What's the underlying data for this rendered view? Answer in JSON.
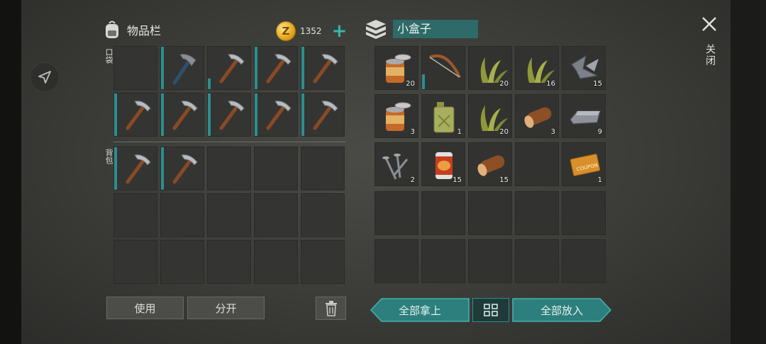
{
  "inventory": {
    "title": "物品栏",
    "coins": "1352",
    "pocket_label": "口袋",
    "backpack_label": "背包",
    "pocket_slots": [
      {
        "item": "",
        "qty": "",
        "durability": 0
      },
      {
        "item": "stone-pickaxe-icon",
        "qty": "",
        "durability": 1.0
      },
      {
        "item": "pickaxe-icon",
        "qty": "",
        "durability": 0.25
      },
      {
        "item": "pickaxe-icon",
        "qty": "",
        "durability": 1.0
      },
      {
        "item": "pickaxe-icon",
        "qty": "",
        "durability": 1.0
      },
      {
        "item": "pickaxe-icon",
        "qty": "",
        "durability": 1.0
      },
      {
        "item": "pickaxe-icon",
        "qty": "",
        "durability": 1.0
      },
      {
        "item": "pickaxe-icon",
        "qty": "",
        "durability": 1.0
      },
      {
        "item": "pickaxe-icon",
        "qty": "",
        "durability": 1.0
      },
      {
        "item": "pickaxe-icon",
        "qty": "",
        "durability": 1.0
      }
    ],
    "backpack_slots": [
      {
        "item": "pickaxe-icon",
        "qty": "",
        "durability": 1.0
      },
      {
        "item": "pickaxe-icon",
        "qty": "",
        "durability": 1.0
      },
      {
        "item": "",
        "qty": "",
        "durability": 0
      },
      {
        "item": "",
        "qty": "",
        "durability": 0
      },
      {
        "item": "",
        "qty": "",
        "durability": 0
      },
      {
        "item": "",
        "qty": "",
        "durability": 0
      },
      {
        "item": "",
        "qty": "",
        "durability": 0
      },
      {
        "item": "",
        "qty": "",
        "durability": 0
      },
      {
        "item": "",
        "qty": "",
        "durability": 0
      },
      {
        "item": "",
        "qty": "",
        "durability": 0
      },
      {
        "item": "",
        "qty": "",
        "durability": 0
      },
      {
        "item": "",
        "qty": "",
        "durability": 0
      },
      {
        "item": "",
        "qty": "",
        "durability": 0
      },
      {
        "item": "",
        "qty": "",
        "durability": 0
      },
      {
        "item": "",
        "qty": "",
        "durability": 0
      }
    ],
    "use_label": "使用",
    "split_label": "分开"
  },
  "box": {
    "title": "小盒子",
    "slots": [
      {
        "item": "open-can-icon",
        "qty": "20",
        "durability": 0
      },
      {
        "item": "bow-icon",
        "qty": "",
        "durability": 0.35
      },
      {
        "item": "grass-icon",
        "qty": "20",
        "durability": 0
      },
      {
        "item": "grass-icon",
        "qty": "16",
        "durability": 0
      },
      {
        "item": "scrap-metal-icon",
        "qty": "15",
        "durability": 0
      },
      {
        "item": "open-can-icon",
        "qty": "3",
        "durability": 0
      },
      {
        "item": "jerrycan-icon",
        "qty": "1",
        "durability": 0
      },
      {
        "item": "grass-icon",
        "qty": "20",
        "durability": 0
      },
      {
        "item": "log-icon",
        "qty": "3",
        "durability": 0
      },
      {
        "item": "iron-ingot-icon",
        "qty": "9",
        "durability": 0
      },
      {
        "item": "nails-icon",
        "qty": "2",
        "durability": 0
      },
      {
        "item": "canned-food-icon",
        "qty": "15",
        "durability": 0
      },
      {
        "item": "log-icon",
        "qty": "15",
        "durability": 0
      },
      {
        "item": "",
        "qty": "",
        "durability": 0
      },
      {
        "item": "coupon-icon",
        "qty": "1",
        "durability": 0
      },
      {
        "item": "",
        "qty": "",
        "durability": 0
      },
      {
        "item": "",
        "qty": "",
        "durability": 0
      },
      {
        "item": "",
        "qty": "",
        "durability": 0
      },
      {
        "item": "",
        "qty": "",
        "durability": 0
      },
      {
        "item": "",
        "qty": "",
        "durability": 0
      },
      {
        "item": "",
        "qty": "",
        "durability": 0
      },
      {
        "item": "",
        "qty": "",
        "durability": 0
      },
      {
        "item": "",
        "qty": "",
        "durability": 0
      },
      {
        "item": "",
        "qty": "",
        "durability": 0
      },
      {
        "item": "",
        "qty": "",
        "durability": 0
      }
    ],
    "take_all_label": "全部拿上",
    "put_all_label": "全部放入"
  },
  "close_label": "关闭",
  "colors": {
    "accent": "#2c8e90",
    "teal_button": "#2c7f7c",
    "box_name_bg": "#2d6a68"
  }
}
